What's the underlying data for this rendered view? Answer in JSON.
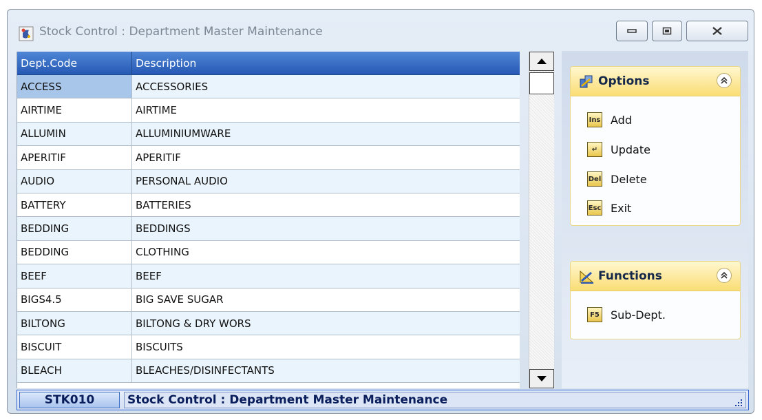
{
  "window": {
    "title": "Stock Control : Department Master Maintenance"
  },
  "grid": {
    "columns": [
      "Dept.Code",
      "Description"
    ],
    "rows": [
      {
        "code": "ACCESS",
        "description": "ACCESSORIES"
      },
      {
        "code": "AIRTIME",
        "description": "AIRTIME"
      },
      {
        "code": "ALLUMIN",
        "description": "ALLUMINIUMWARE"
      },
      {
        "code": "APERITIF",
        "description": "APERITIF"
      },
      {
        "code": "AUDIO",
        "description": "PERSONAL AUDIO"
      },
      {
        "code": "BATTERY",
        "description": "BATTERIES"
      },
      {
        "code": "BEDDING",
        "description": "BEDDINGS"
      },
      {
        "code": "BEDDING",
        "description": "CLOTHING"
      },
      {
        "code": "BEEF",
        "description": "BEEF"
      },
      {
        "code": "BIGS4.5",
        "description": "BIG SAVE SUGAR"
      },
      {
        "code": "BILTONG",
        "description": "BILTONG & DRY WORS"
      },
      {
        "code": "BISCUIT",
        "description": "BISCUITS"
      },
      {
        "code": "BLEACH",
        "description": "BLEACHES/DISINFECTANTS"
      }
    ]
  },
  "options_panel": {
    "title": "Options",
    "icon": "options-icon",
    "items": [
      {
        "key": "Ins",
        "label": "Add",
        "icon": "ins-key-icon"
      },
      {
        "key": "↵",
        "label": "Update",
        "icon": "enter-key-icon"
      },
      {
        "key": "Del",
        "label": "Delete",
        "icon": "del-key-icon"
      },
      {
        "key": "Esc",
        "label": "Exit",
        "icon": "esc-key-icon"
      }
    ]
  },
  "functions_panel": {
    "title": "Functions",
    "icon": "functions-icon",
    "items": [
      {
        "key": "F5",
        "label": "Sub-Dept.",
        "icon": "f5-key-icon"
      }
    ]
  },
  "statusbar": {
    "code": "STK010",
    "text": "Stock Control : Department Master Maintenance"
  },
  "colors": {
    "header_blue": "#2659b4",
    "row_alt": "#eaf4fc",
    "selected_cell": "#a8c6ea",
    "panel_header": "#fadd74",
    "status_border": "#2c5fd0"
  }
}
